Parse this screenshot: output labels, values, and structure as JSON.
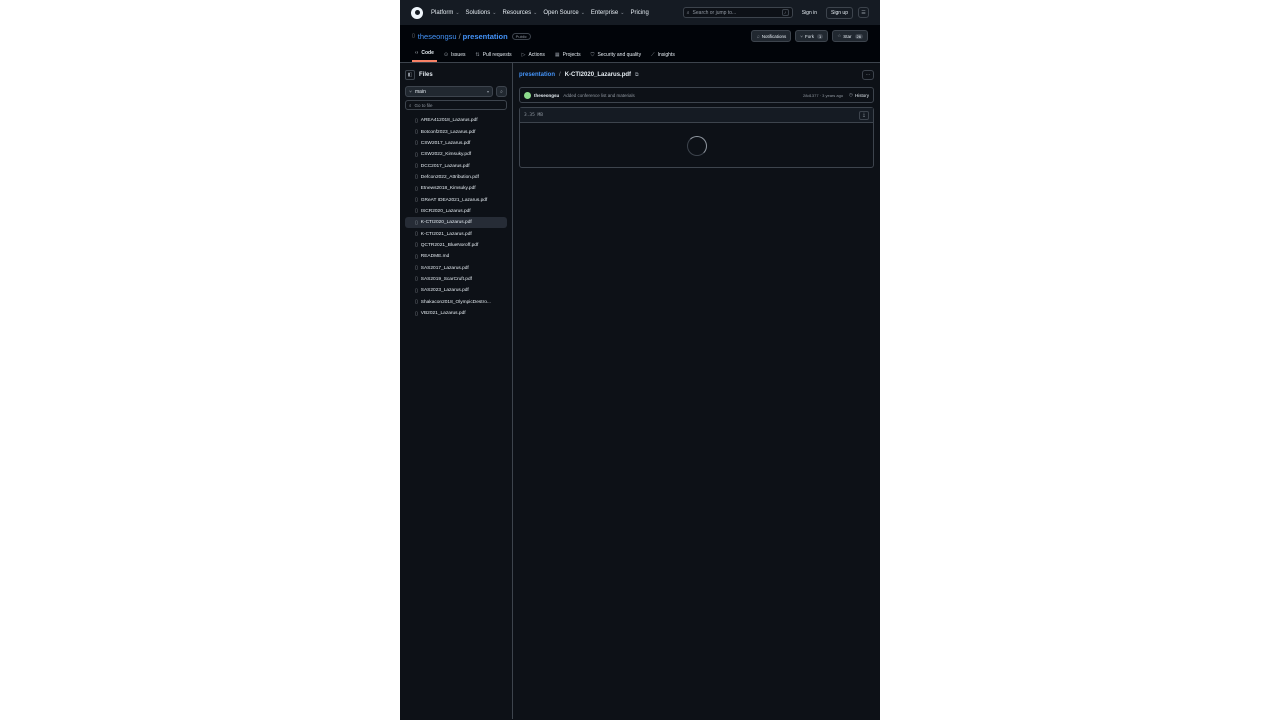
{
  "header": {
    "nav": [
      "Platform",
      "Solutions",
      "Resources",
      "Open Source",
      "Enterprise",
      "Pricing"
    ],
    "search_placeholder": "Search or jump to...",
    "search_key": "/",
    "sign_in": "Sign in",
    "sign_up": "Sign up"
  },
  "repo": {
    "owner": "theseongsu",
    "separator": "/",
    "name": "presentation",
    "visibility": "Public",
    "notifications": "Notifications",
    "fork_label": "Fork",
    "fork_count": "1",
    "star_label": "Star",
    "star_count": "26"
  },
  "tabs": [
    {
      "label": "Code",
      "icon": "‹›"
    },
    {
      "label": "Issues",
      "icon": "⊙"
    },
    {
      "label": "Pull requests",
      "icon": "⇅"
    },
    {
      "label": "Actions",
      "icon": "▷"
    },
    {
      "label": "Projects",
      "icon": "▦"
    },
    {
      "label": "Security and quality",
      "icon": "⛉"
    },
    {
      "label": "Insights",
      "icon": "⟋"
    }
  ],
  "sidebar": {
    "title": "Files",
    "branch": "main",
    "goto_placeholder": "Go to file",
    "files": [
      "AREA412018_Lazarus.pdf",
      "Botconf2023_Lazarus.pdf",
      "CSW2017_Lazarus.pdf",
      "CSW2022_Kimsuky.pdf",
      "DCC2017_Lazarus.pdf",
      "Defcon2022_Attribution.pdf",
      "Etnews2018_Kimsuky.pdf",
      "GReAT IDEA2021_Lazarus.pdf",
      "ISCR2020_Lazarus.pdf",
      "K-CTI2020_Lazarus.pdf",
      "K-CTI2021_Lazarus.pdf",
      "QCTR2021_BlueNoroff.pdf",
      "README.md",
      "SAS2017_Lazarus.pdf",
      "SAS2019_ScarCruft.pdf",
      "SAS2023_Lazarus.pdf",
      "Shakacon2018_OlympicDestro...",
      "VB2021_Lazarus.pdf"
    ],
    "selected_index": 9
  },
  "main": {
    "crumb_repo": "presentation",
    "crumb_sep": "/",
    "crumb_file": "K-CTI2020_Lazarus.pdf",
    "commit": {
      "author": "theseongsu",
      "message": "Added conference list and materials",
      "sha": "28d1377",
      "time": "3 years ago",
      "history": "History"
    },
    "file_size": "3.35 MB"
  }
}
